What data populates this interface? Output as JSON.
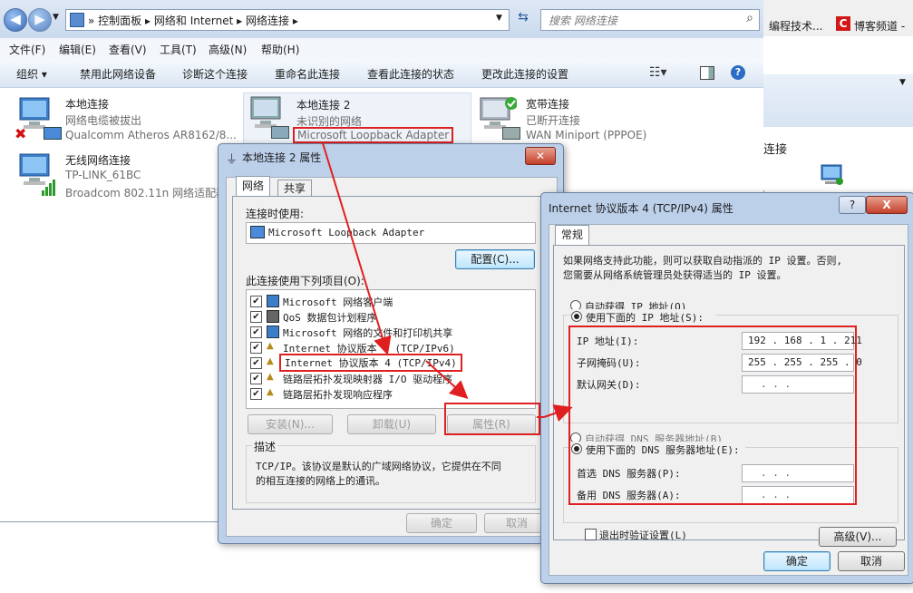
{
  "explorer": {
    "breadcrumb": [
      "控制面板",
      "网络和 Internet",
      "网络连接"
    ],
    "search_placeholder": "搜索 网络连接",
    "menu": [
      "文件(F)",
      "编辑(E)",
      "查看(V)",
      "工具(T)",
      "高级(N)",
      "帮助(H)"
    ],
    "commands": [
      "组织 ▾",
      "禁用此网络设备",
      "诊断这个连接",
      "重命名此连接",
      "查看此连接的状态",
      "更改此连接的设置"
    ],
    "connections": [
      {
        "name": "本地连接",
        "status": "网络电缆被拔出",
        "device": "Qualcomm Atheros AR8162/8..."
      },
      {
        "name": "本地连接 2",
        "status": "未识别的网络",
        "device": "Microsoft Loopback Adapter"
      },
      {
        "name": "宽带连接",
        "status": "已断开连接",
        "device": "WAN Miniport (PPPOE)"
      },
      {
        "name": "无线网络连接",
        "status": "TP-LINK_61BC",
        "device": "Broadcom 802.11n 网络适配器"
      }
    ]
  },
  "taskbar": {
    "item1": "编程技术...",
    "item2": "博客频道 -",
    "partial_text": "连接"
  },
  "dialog1": {
    "title": "本地连接 2 属性",
    "tabs": [
      "网络",
      "共享"
    ],
    "connect_using_label": "连接时使用:",
    "adapter": "Microsoft Loopback Adapter",
    "configure_button": "配置(C)...",
    "items_label": "此连接使用下列项目(O):",
    "items": [
      "Microsoft 网络客户端",
      "QoS 数据包计划程序",
      "Microsoft 网络的文件和打印机共享",
      "Internet 协议版本 6 (TCP/IPv6)",
      "Internet 协议版本 4 (TCP/IPv4)",
      "链路层拓扑发现映射器 I/O 驱动程序",
      "链路层拓扑发现响应程序"
    ],
    "install_button": "安装(N)...",
    "uninstall_button": "卸载(U)",
    "properties_button": "属性(R)",
    "description_label": "描述",
    "description_line1": "TCP/IP。该协议是默认的广域网络协议，它提供在不同",
    "description_line2": "的相互连接的网络上的通讯。",
    "ok_button": "确定",
    "cancel_button": "取消"
  },
  "dialog2": {
    "title": "Internet 协议版本 4 (TCP/IPv4) 属性",
    "help": "?",
    "close": "X",
    "tab": "常规",
    "intro_line1": "如果网络支持此功能，则可以获取自动指派的 IP 设置。否则,",
    "intro_line2": "您需要从网络系统管理员处获得适当的 IP 设置。",
    "auto_ip": "自动获得 IP 地址(O)",
    "manual_ip": "使用下面的 IP 地址(S):",
    "ip_label": "IP 地址(I):",
    "ip_value": "192 . 168 .  1  . 211",
    "mask_label": "子网掩码(U):",
    "mask_value": "255 . 255 . 255 .  0",
    "gateway_label": "默认网关(D):",
    "empty_ip": "  .     .     .",
    "auto_dns": "自动获得 DNS 服务器地址(B)",
    "manual_dns": "使用下面的 DNS 服务器地址(E):",
    "pref_dns_label": "首选 DNS 服务器(P):",
    "alt_dns_label": "备用 DNS 服务器(A):",
    "validate_label": "退出时验证设置(L)",
    "advanced_button": "高级(V)...",
    "ok_button": "确定",
    "cancel_button": "取消"
  },
  "colors": {
    "annotation": "#e02020",
    "accent": "#3c7fb1"
  }
}
